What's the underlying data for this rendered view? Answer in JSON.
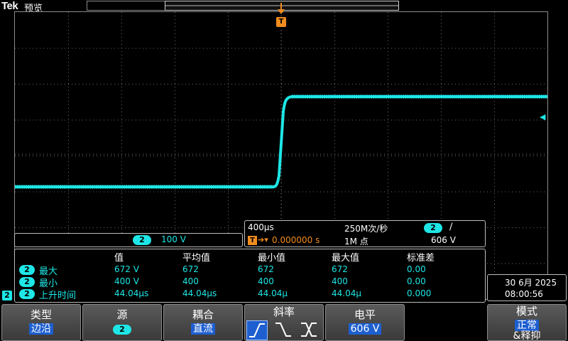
{
  "header": {
    "brand": "Tek",
    "mode": "预览"
  },
  "trigger": {
    "marker_label": "T"
  },
  "channel": {
    "number": "2",
    "scale": "100 V",
    "color": "#1ee6e6"
  },
  "timebase": {
    "scale": "400µs",
    "sample_rate": "250M次/秒",
    "trigger_source": "2",
    "trigger_slope_glyph": "∕",
    "position_marker": "T",
    "position_arrow": "➔▾",
    "position": "0.000000 s",
    "record_length": "1M 点",
    "trigger_level": "606 V"
  },
  "measurements": {
    "headers": [
      "值",
      "平均值",
      "最小值",
      "最大值",
      "标准差"
    ],
    "rows": [
      {
        "channel": "2",
        "name": "最大",
        "values": [
          "672 V",
          "672",
          "672",
          "672",
          "0.00"
        ]
      },
      {
        "channel": "2",
        "name": "最小",
        "values": [
          "400 V",
          "400",
          "400",
          "400",
          "0.00"
        ]
      },
      {
        "channel": "2",
        "name": "上升时间",
        "values": [
          "44.04µs",
          "44.04µs",
          "44.04µ",
          "44.04µ",
          "0.000"
        ]
      }
    ]
  },
  "side_channel_badge": "2",
  "datetime": {
    "date": "30 6月 2025",
    "time": "08:00:56"
  },
  "menu": {
    "type": {
      "label": "类型",
      "value": "边沿"
    },
    "source": {
      "label": "源",
      "value": "2"
    },
    "coupling": {
      "label": "耦合",
      "value": "直流"
    },
    "slope": {
      "label": "斜率"
    },
    "level": {
      "label": "电平",
      "value": "606 V"
    },
    "mode": {
      "label": "模式",
      "value": "正常",
      "value2": "&释抑"
    }
  }
}
